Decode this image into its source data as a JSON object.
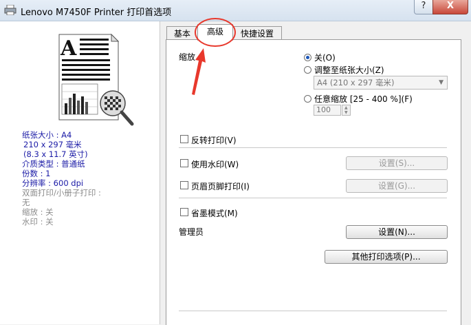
{
  "window": {
    "title": "Lenovo M7450F Printer 打印首选项",
    "help_label": "?",
    "close_label": "X"
  },
  "tabs": [
    {
      "label": "基本"
    },
    {
      "label": "高级"
    },
    {
      "label": "快捷设置"
    }
  ],
  "summary": {
    "paper_size_label": "纸张大小 : A4",
    "paper_size_mm": "210 x 297 毫米",
    "paper_size_in": "(8.3 x 11.7 英寸)",
    "media_type": "介质类型 : 普通纸",
    "copies": "份数 : 1",
    "resolution": "分辨率 : 600 dpi",
    "duplex": "双面打印/小册子打印 :",
    "duplex_value": "无",
    "scaling": "缩放 : 关",
    "watermark": "水印 : 关"
  },
  "advanced": {
    "scaling_label": "缩放",
    "option_off": "关(O)",
    "option_fit": "调整至纸张大小(Z)",
    "fit_paper_value": "A4 (210 x 297 毫米)",
    "option_custom": "任意缩放 [25 - 400 %](F)",
    "custom_value": "100",
    "reverse_print": "反转打印(V)",
    "use_watermark": "使用水印(W)",
    "watermark_settings": "设置(S)...",
    "header_footer": "页眉页脚打印(I)",
    "header_footer_settings": "设置(G)...",
    "toner_save": "省墨模式(M)",
    "administrator": "管理员",
    "admin_settings": "设置(N)...",
    "other_options": "其他打印选项(P)..."
  },
  "colors": {
    "accent": "#1b56b8",
    "annotation": "#e8382c",
    "info_text": "#1a1aa6"
  }
}
